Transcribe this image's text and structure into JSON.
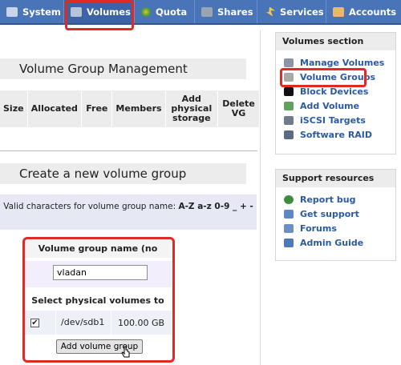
{
  "tabs": [
    {
      "label": "System",
      "icon": "system-icon"
    },
    {
      "label": "Volumes",
      "icon": "volumes-icon"
    },
    {
      "label": "Quota",
      "icon": "quota-icon"
    },
    {
      "label": "Shares",
      "icon": "shares-icon"
    },
    {
      "label": "Services",
      "icon": "services-icon"
    },
    {
      "label": "Accounts",
      "icon": "accounts-icon"
    }
  ],
  "vgm": {
    "title": "Volume Group Management",
    "columns": [
      "Size",
      "Allocated",
      "Free",
      "Members",
      "Add physical storage",
      "Delete VG"
    ]
  },
  "create": {
    "title": "Create a new volume group",
    "valid_prefix": "Valid characters for volume group name:",
    "valid_chars": "A-Z a-z 0-9 _ + -",
    "name_label": "Volume group name (no spaces)",
    "name_value": "vladan",
    "pv_label": "Select physical volumes to add",
    "pv": {
      "checked": true,
      "device": "/dev/sdb1",
      "size": "100.00 GB"
    },
    "button": "Add volume group"
  },
  "sidebar": {
    "volumes_title": "Volumes section",
    "volume_items": [
      {
        "label": "Manage Volumes",
        "icon": "manage-volumes-icon"
      },
      {
        "label": "Volume Groups",
        "icon": "volume-groups-icon"
      },
      {
        "label": "Block Devices",
        "icon": "block-devices-icon"
      },
      {
        "label": "Add Volume",
        "icon": "add-volume-icon"
      },
      {
        "label": "iSCSI Targets",
        "icon": "iscsi-icon"
      },
      {
        "label": "Software RAID",
        "icon": "raid-icon"
      }
    ],
    "support_title": "Support resources",
    "support_items": [
      {
        "label": "Report bug",
        "icon": "bug-icon"
      },
      {
        "label": "Get support",
        "icon": "support-icon"
      },
      {
        "label": "Forums",
        "icon": "forums-icon"
      },
      {
        "label": "Admin Guide",
        "icon": "guide-icon"
      }
    ]
  },
  "colors": {
    "tab_bar": "#4a74b8",
    "link": "#2b5aa5",
    "highlight": "#e02b24"
  }
}
